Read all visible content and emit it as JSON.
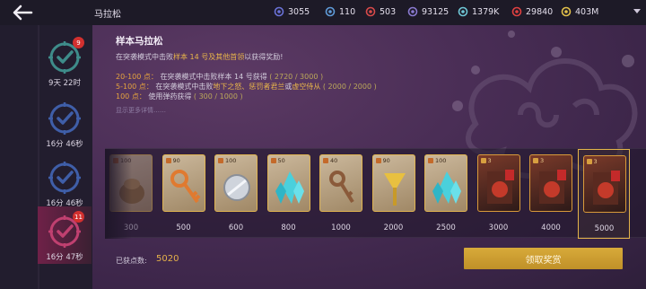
{
  "header": {
    "back_icon": "arrow-left-icon",
    "title": "马拉松",
    "resources": [
      {
        "icon": "crosshair-icon",
        "color": "#6a72d8",
        "value": "3055"
      },
      {
        "icon": "battery-icon",
        "color": "#5f9bd8",
        "value": "110"
      },
      {
        "icon": "token-icon",
        "color": "#d84a4a",
        "value": "503"
      },
      {
        "icon": "diamond-icon",
        "color": "#8a7ad0",
        "value": "93125"
      },
      {
        "icon": "cycle-icon",
        "color": "#6fc7d6",
        "value": "1379K"
      },
      {
        "icon": "gem-icon",
        "color": "#e04040",
        "value": "29840"
      },
      {
        "icon": "coin-icon",
        "color": "#e2c04a",
        "value": "403M"
      }
    ]
  },
  "sidebar": {
    "items": [
      {
        "time": "9天 22时",
        "badge": "9",
        "active": false,
        "ring_color": "#3e8c8a"
      },
      {
        "time": "16分 46秒",
        "badge": "",
        "active": false,
        "ring_color": "#3f5ea8"
      },
      {
        "time": "16分 46秒",
        "badge": "",
        "active": false,
        "ring_color": "#3f5ea8"
      },
      {
        "time": "16分 47秒",
        "badge": "11",
        "active": true,
        "ring_color": "#c04070"
      }
    ]
  },
  "panel": {
    "title": "样本马拉松",
    "desc_prefix": "在突袭模式中击败",
    "desc_highlight": "样本 14 号及其他首领",
    "desc_suffix": "以获得奖励!",
    "rules": [
      {
        "range": "20-100 点：",
        "text_a": "在突袭模式中击败样本 14 号获得",
        "highlight": "",
        "text_b": "",
        "progress": "( 2720 / 3000 )"
      },
      {
        "range": "5-100 点：",
        "text_a": "在突袭模式中击败",
        "highlight": "地下之怒、惩罚者君兰",
        "text_b": "或",
        "highlight2": "虚空侍从",
        "progress": "( 2000 / 2000 )"
      },
      {
        "range": "100 点：",
        "text_a": "使用弹药获得",
        "highlight": "",
        "text_b": "",
        "progress": "( 300 / 1000 )"
      }
    ],
    "more_link": "显示更多详情……",
    "rewards": [
      {
        "points": "300",
        "count": "100",
        "item": "bag-icon",
        "claimed": true,
        "hero": false
      },
      {
        "points": "500",
        "count": "90",
        "item": "key-orange-icon",
        "claimed": false,
        "hero": false
      },
      {
        "points": "600",
        "count": "100",
        "item": "orb-icon",
        "claimed": false,
        "hero": false
      },
      {
        "points": "800",
        "count": "50",
        "item": "crystal-icon",
        "claimed": false,
        "hero": false
      },
      {
        "points": "1000",
        "count": "40",
        "item": "key-bronze-icon",
        "claimed": false,
        "hero": false
      },
      {
        "points": "2000",
        "count": "90",
        "item": "key-gold-icon",
        "claimed": false,
        "hero": false
      },
      {
        "points": "2500",
        "count": "100",
        "item": "crystal-icon",
        "claimed": false,
        "hero": false
      },
      {
        "points": "3000",
        "count": "3",
        "item": "hero-card-icon",
        "claimed": false,
        "hero": true
      },
      {
        "points": "4000",
        "count": "3",
        "item": "hero-card-icon",
        "claimed": false,
        "hero": true
      },
      {
        "points": "5000",
        "count": "3",
        "item": "hero-card-icon",
        "claimed": false,
        "hero": true
      }
    ],
    "earned_label": "已获点数:",
    "earned_value": "5020",
    "claim_button": "领取奖赏"
  }
}
